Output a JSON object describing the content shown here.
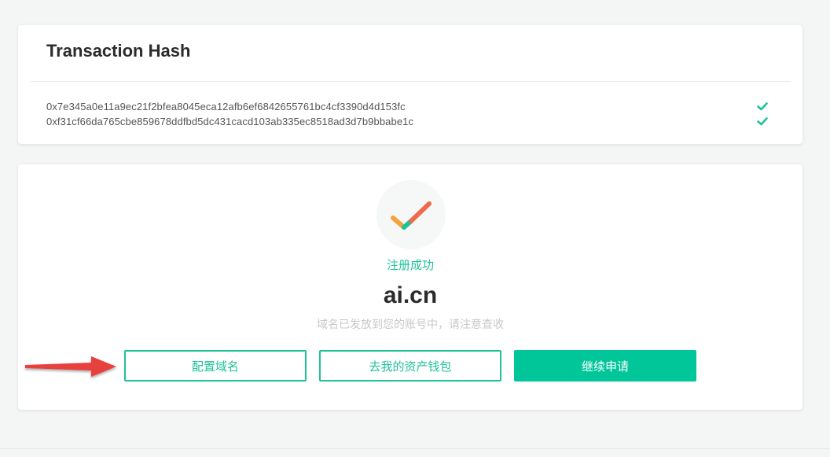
{
  "hash_panel": {
    "title": "Transaction Hash",
    "hashes": [
      "0x7e345a0e11a9ec21f2bfea8045eca12afb6ef6842655761bc4cf3390d4d153fc",
      "0xf31cf66da765cbe859678ddfbd5dc431cacd103ab335ec8518ad3d7b9bbabe1c"
    ]
  },
  "result_panel": {
    "status": "注册成功",
    "domain": "ai.cn",
    "notice": "域名已发放到您的账号中，请注意查收",
    "buttons": {
      "configure": "配置域名",
      "wallet": "去我的资产钱包",
      "continue": "继续申请"
    }
  },
  "colors": {
    "accent": "#1ec29a",
    "arrow": "#e8403c",
    "check_orange": "#f4a23b",
    "check_red": "#ef6a4c"
  },
  "icons": {
    "success": "check-mark-icon",
    "hash_status": "check-icon",
    "pointer": "red-arrow-annotation"
  }
}
